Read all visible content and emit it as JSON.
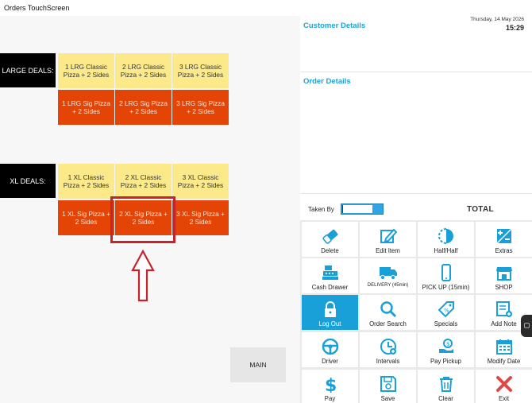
{
  "window": {
    "title": "Orders TouchScreen"
  },
  "deals": {
    "large": {
      "label": "LARGE DEALS:",
      "top": [
        "1 LRG Classic Pizza + 2 Sides",
        "2 LRG Classic Pizza + 2 Sides",
        "3 LRG Classic Pizza + 2 Sides"
      ],
      "bottom": [
        "1 LRG Sig Pizza + 2 Sides",
        "2 LRG Sig Pizza + 2 Sides",
        "3 LRG Sig Pizza + 2 Sides"
      ]
    },
    "xl": {
      "label": "XL DEALS:",
      "top": [
        "1 XL Classic Pizza + 2 Sides",
        "2 XL Classic Pizza + 2 Sides",
        "3 XL Classic Pizza + 2 Sides"
      ],
      "bottom": [
        "1 XL Sig Pizza + 2 Sides",
        "2 XL Sig Pizza + 2 Sides",
        "3 XL Sig Pizza + 2 Sides"
      ]
    }
  },
  "main_button": "MAIN",
  "header": {
    "date": "Thursday, 14 May 2026",
    "time": "15:29"
  },
  "sections": {
    "customer": "Customer Details",
    "order": "Order Details"
  },
  "taken_by": {
    "label": "Taken By",
    "value": ""
  },
  "total": {
    "label": "TOTAL"
  },
  "colors": {
    "accent": "#1aa0d9",
    "deal_yellow": "#fbe98a",
    "deal_orange": "#e54407",
    "highlight": "#c6232c"
  },
  "functions": [
    {
      "label": "Delete",
      "icon": "eraser-icon"
    },
    {
      "label": "Edit Item",
      "icon": "edit-icon"
    },
    {
      "label": "Half/Half",
      "icon": "half-circle-icon"
    },
    {
      "label": "Extras",
      "icon": "plus-minus-icon"
    },
    {
      "label": "Cash Drawer",
      "icon": "cash-register-icon"
    },
    {
      "label": "DELIVERY (45min)",
      "icon": "truck-icon"
    },
    {
      "label": "PICK UP (15min)",
      "icon": "phone-icon"
    },
    {
      "label": "SHOP",
      "icon": "shop-icon"
    },
    {
      "label": "Log Out",
      "icon": "lock-icon"
    },
    {
      "label": "Order Search",
      "icon": "search-icon"
    },
    {
      "label": "Specials",
      "icon": "tag-icon"
    },
    {
      "label": "Add Note",
      "icon": "note-icon"
    },
    {
      "label": "Driver",
      "icon": "steering-wheel-icon"
    },
    {
      "label": "Intervals",
      "icon": "clock-icon"
    },
    {
      "label": "Pay Pickup",
      "icon": "hand-pay-icon"
    },
    {
      "label": "Modify Date",
      "icon": "calendar-icon"
    },
    {
      "label": "Pay",
      "icon": "dollar-icon"
    },
    {
      "label": "Save",
      "icon": "save-icon"
    },
    {
      "label": "Clear",
      "icon": "trash-icon"
    },
    {
      "label": "Exit",
      "icon": "close-icon"
    }
  ]
}
